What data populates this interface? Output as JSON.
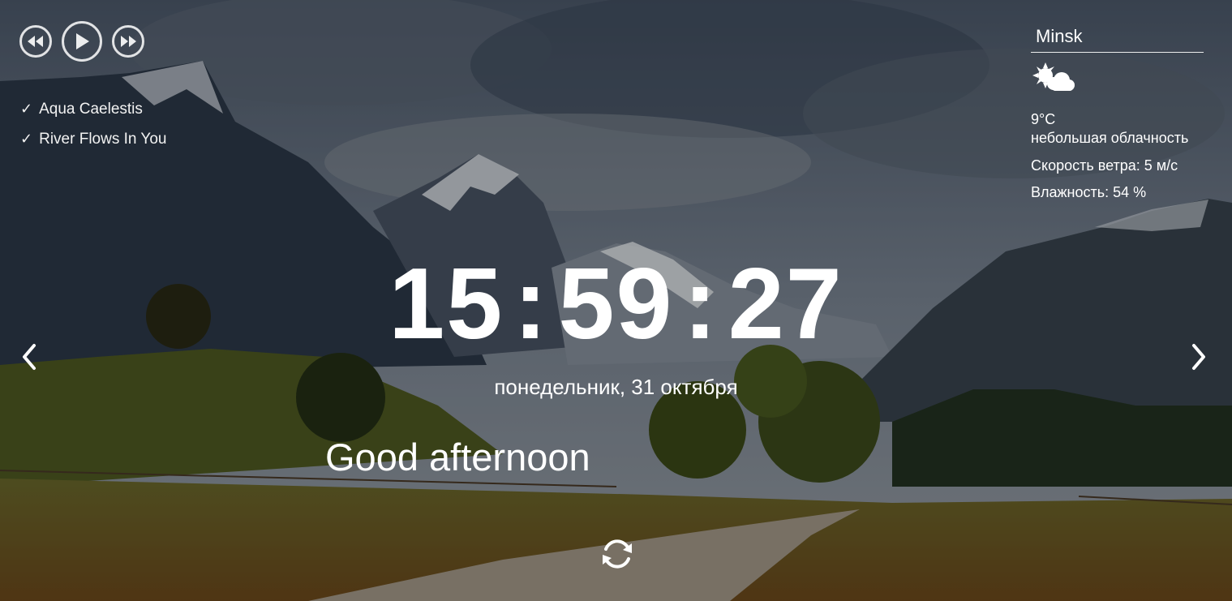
{
  "player": {
    "prev_icon": "rewind-icon",
    "play_icon": "play-icon",
    "next_icon": "fast-forward-icon",
    "playlist": [
      {
        "mark": "✓",
        "title": "Aqua Caelestis"
      },
      {
        "mark": "✓",
        "title": "River Flows In You"
      }
    ]
  },
  "weather": {
    "city": "Minsk",
    "icon": "partly-cloudy-icon",
    "temperature": "9°C",
    "description": "небольшая облачность",
    "wind": "Скорость ветра: 5 м/с",
    "humidity": "Влажность: 54 %"
  },
  "clock": {
    "hours": "15",
    "minutes": "59",
    "seconds": "27",
    "separator": ":"
  },
  "date": "понедельник, 31 октября",
  "greeting": "Good afternoon",
  "nav": {
    "prev_icon": "chevron-left-icon",
    "next_icon": "chevron-right-icon",
    "refresh_icon": "refresh-icon"
  }
}
